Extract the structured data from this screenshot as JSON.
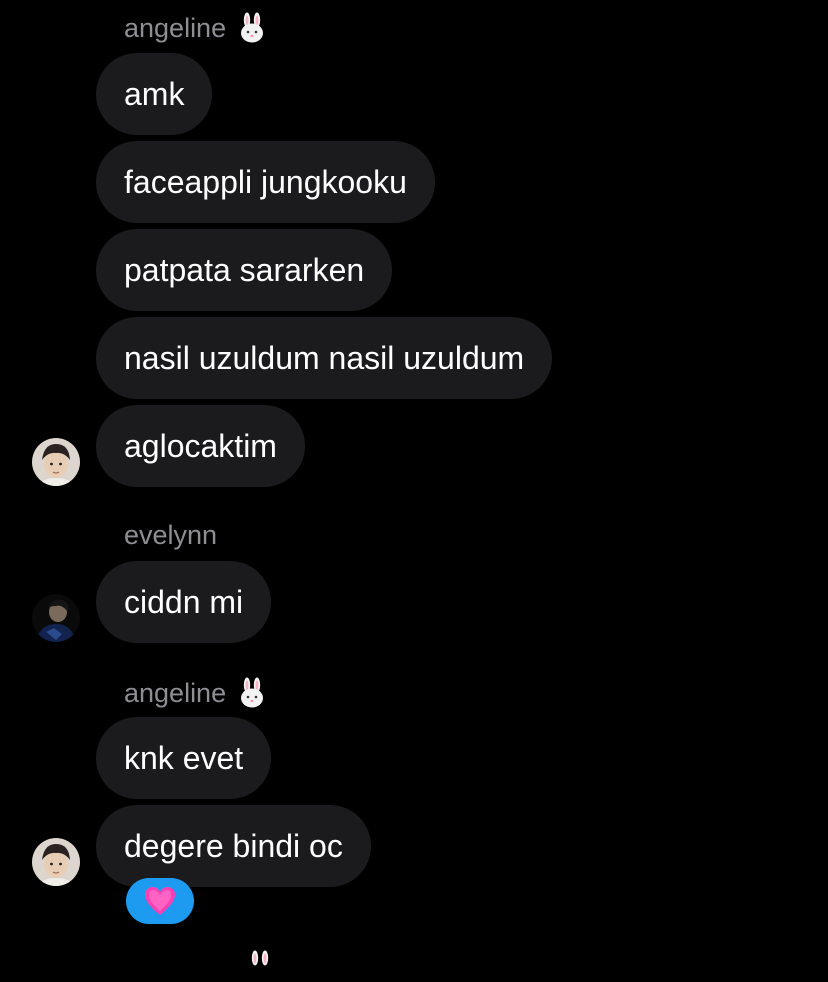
{
  "colors": {
    "background": "#000000",
    "bubble": "#1b1b1d",
    "sender_name": "#8e8e93",
    "message_text": "#ffffff",
    "reaction_pill": "#1d9bf0",
    "heart": "#ff3fb4"
  },
  "groups": [
    {
      "sender": "angeline",
      "sender_icon": "bunny-emoji-icon",
      "avatar_icon": "user-avatar-icon",
      "messages": [
        "amk",
        "faceappli jungkooku",
        "patpata sararken",
        "nasil uzuldum nasil uzuldum",
        "aglocaktim"
      ]
    },
    {
      "sender": "evelynn",
      "avatar_icon": "user-avatar-icon",
      "messages": [
        "ciddn mi"
      ]
    },
    {
      "sender": "angeline",
      "sender_icon": "bunny-emoji-icon",
      "avatar_icon": "user-avatar-icon",
      "messages": [
        "knk evet",
        "degere bindi oc"
      ],
      "reaction": {
        "icon": "pink-heart-icon"
      }
    }
  ]
}
